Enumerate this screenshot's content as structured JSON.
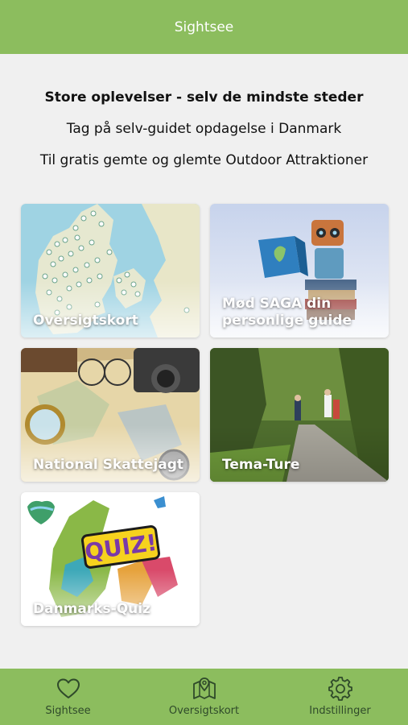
{
  "header": {
    "title": "Sightsee"
  },
  "intro": {
    "headline": "Store oplevelser - selv de mindste steder",
    "line1": "Tag på selv-guidet opdagelse i Danmark",
    "line2": "Til gratis gemte og glemte Outdoor Attraktioner"
  },
  "tiles": [
    {
      "label": "Oversigtskort",
      "image": "map-of-denmark-with-pins"
    },
    {
      "label": "Mød SAGA din personlige guide",
      "image": "robot-reading-book"
    },
    {
      "label": "National Skattejagt",
      "image": "treasure-map-with-compass-and-camera"
    },
    {
      "label": "Tema-Ture",
      "image": "cyclists-on-forest-path"
    },
    {
      "label": "Danmarks-Quiz",
      "image": "quiz-map-of-denmark"
    }
  ],
  "tabbar": {
    "items": [
      {
        "label": "Sightsee",
        "icon": "heart-icon"
      },
      {
        "label": "Oversigtskort",
        "icon": "map-pin-icon"
      },
      {
        "label": "Indstillinger",
        "icon": "gear-icon"
      }
    ]
  },
  "colors": {
    "brand_green": "#8cbd5e",
    "background": "#f0f0f0"
  }
}
